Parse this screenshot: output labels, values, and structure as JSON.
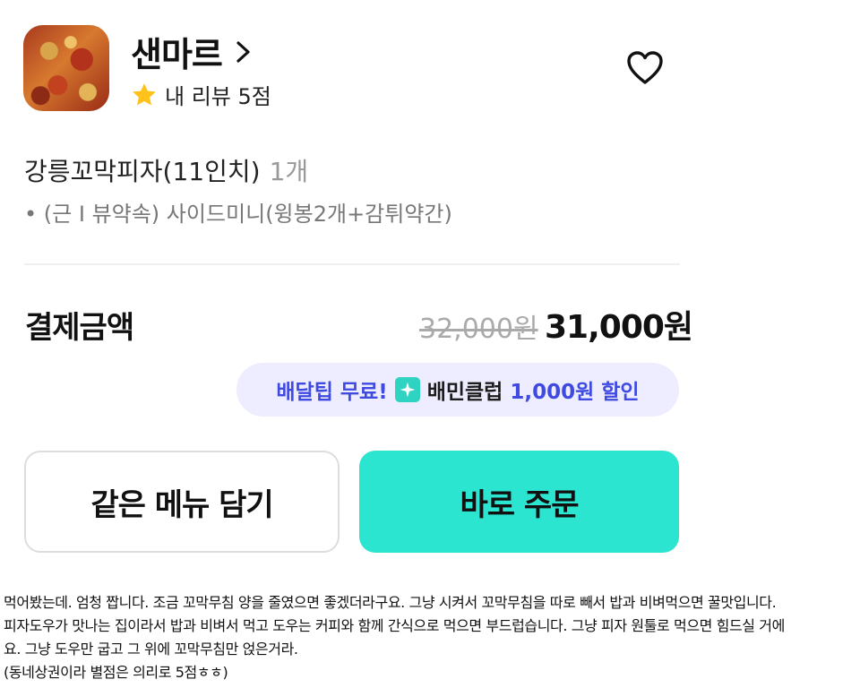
{
  "store": {
    "name": "샌마르",
    "my_review": "내 리뷰 5점"
  },
  "order": {
    "menu_name": "강릉꼬막피자(11인치)",
    "quantity": "1개",
    "option": "• (근 I 뷰약속) 사이드미니(윙봉2개+감튀약간)"
  },
  "payment": {
    "label": "결제금액",
    "original_price": "32,000원",
    "final_price": "31,000원"
  },
  "promo": {
    "free_delivery": "배달팁 무료!",
    "club_prefix": "배민클럽",
    "club_discount": "1,000원 할인"
  },
  "buttons": {
    "add_same": "같은 메뉴 담기",
    "order_now": "바로 주문"
  },
  "review_lines": [
    "먹어봤는데. 엄청 짭니다. 조금 꼬막무침 양을 줄였으면 좋겠더라구요. 그냥 시켜서 꼬막무침을 따로 빼서 밥과 비벼먹으면 꿀맛입니다.",
    "피자도우가 맛나는 집이라서 밥과 비벼서 먹고 도우는 커피와 함께 간식으로 먹으면 부드럽습니다. 그냥 피자 원툴로 먹으면 힘드실 거에",
    "요. 그냥 도우만 굽고 그 위에 꼬막무침만 얹은거라.",
    "(동네상권이라 별점은 의리로 5점ㅎㅎ)"
  ],
  "colors": {
    "mint": "#2be5d0",
    "promo_bg": "#eeecff",
    "promo_blue": "#3f4ae0",
    "star": "#ffc21a"
  }
}
